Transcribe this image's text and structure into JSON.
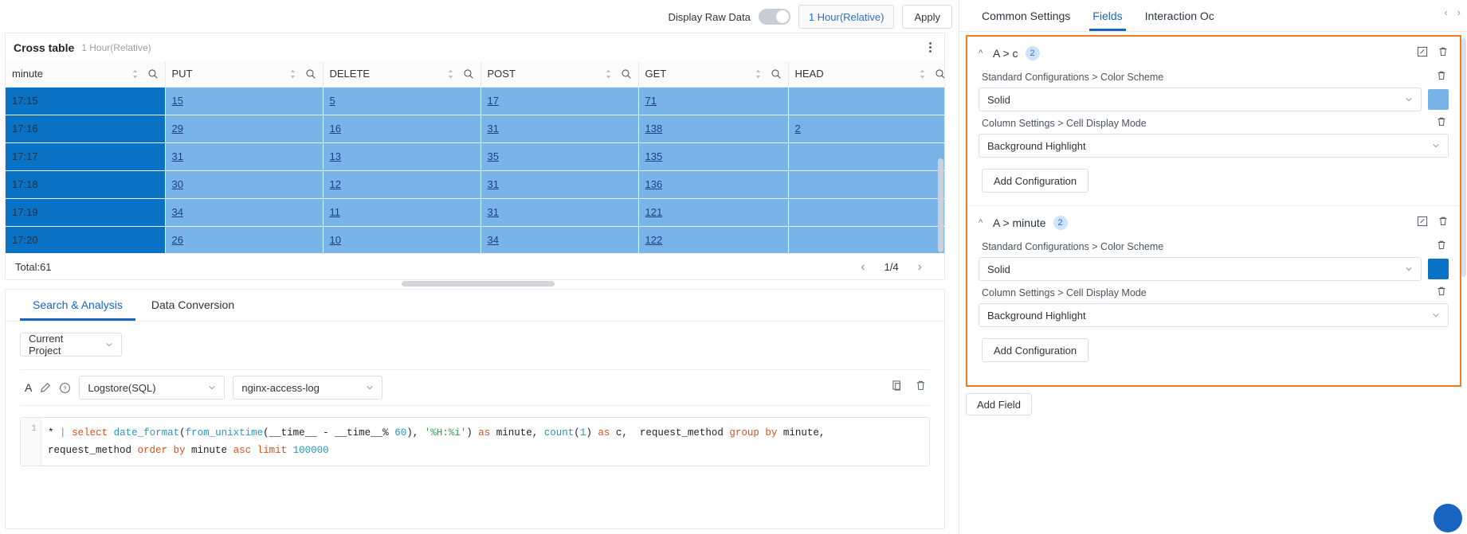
{
  "toolbar": {
    "raw_data_label": "Display Raw Data",
    "raw_data_on": false,
    "time_range": "1 Hour(Relative)",
    "apply_label": "Apply"
  },
  "cross_table": {
    "title": "Cross table",
    "subtitle": "1 Hour(Relative)",
    "more_icon": "kebab-menu-icon",
    "columns": [
      "minute",
      "PUT",
      "DELETE",
      "POST",
      "GET",
      "HEAD"
    ],
    "rows": [
      {
        "minute": "17:15",
        "PUT": "15",
        "DELETE": "5",
        "POST": "17",
        "GET": "71",
        "HEAD": ""
      },
      {
        "minute": "17:16",
        "PUT": "29",
        "DELETE": "16",
        "POST": "31",
        "GET": "138",
        "HEAD": "2"
      },
      {
        "minute": "17:17",
        "PUT": "31",
        "DELETE": "13",
        "POST": "35",
        "GET": "135",
        "HEAD": ""
      },
      {
        "minute": "17:18",
        "PUT": "30",
        "DELETE": "12",
        "POST": "31",
        "GET": "136",
        "HEAD": ""
      },
      {
        "minute": "17:19",
        "PUT": "34",
        "DELETE": "11",
        "POST": "31",
        "GET": "121",
        "HEAD": ""
      },
      {
        "minute": "17:20",
        "PUT": "26",
        "DELETE": "10",
        "POST": "34",
        "GET": "122",
        "HEAD": ""
      }
    ],
    "total": "Total:61",
    "page": "1/4",
    "prev_icon": "chevron-left-icon",
    "next_icon": "chevron-right-icon",
    "key_column_color": "#0a72c4",
    "value_column_color": "#79b4e8"
  },
  "bottom": {
    "tabs": [
      {
        "label": "Search & Analysis",
        "active": true
      },
      {
        "label": "Data Conversion",
        "active": false
      }
    ],
    "project_select": "Current Project",
    "query_letter": "A",
    "logstore_select": "Logstore(SQL)",
    "store_select": "nginx-access-log",
    "sql_line_number": "1",
    "sql": {
      "star": "*",
      "pipe": "|",
      "full_text": "* | select date_format(from_unixtime(__time__ - __time__% 60), '%H:%i') as minute, count(1) as c,  request_method group by minute, request_method order by minute asc limit 100000",
      "tokens": [
        {
          "t": "*",
          "c": "star"
        },
        {
          "t": " ",
          "c": "id"
        },
        {
          "t": "|",
          "c": "pipe"
        },
        {
          "t": " ",
          "c": "id"
        },
        {
          "t": "select",
          "c": "kw"
        },
        {
          "t": " ",
          "c": "id"
        },
        {
          "t": "date_format",
          "c": "fn"
        },
        {
          "t": "(",
          "c": "id"
        },
        {
          "t": "from_unixtime",
          "c": "fn"
        },
        {
          "t": "(__time__ - __time__% ",
          "c": "id"
        },
        {
          "t": "60",
          "c": "num"
        },
        {
          "t": "), ",
          "c": "id"
        },
        {
          "t": "'%H:%i'",
          "c": "str"
        },
        {
          "t": ") ",
          "c": "id"
        },
        {
          "t": "as",
          "c": "kw"
        },
        {
          "t": " minute, ",
          "c": "id"
        },
        {
          "t": "count",
          "c": "fn"
        },
        {
          "t": "(",
          "c": "id"
        },
        {
          "t": "1",
          "c": "num"
        },
        {
          "t": ") ",
          "c": "id"
        },
        {
          "t": "as",
          "c": "kw"
        },
        {
          "t": " c,  request_method ",
          "c": "id"
        },
        {
          "t": "group by",
          "c": "kw"
        },
        {
          "t": " minute,",
          "c": "id"
        }
      ],
      "tokens_line2": [
        {
          "t": "request_method ",
          "c": "id"
        },
        {
          "t": "order by",
          "c": "kw"
        },
        {
          "t": " minute ",
          "c": "id"
        },
        {
          "t": "asc",
          "c": "kw"
        },
        {
          "t": " ",
          "c": "id"
        },
        {
          "t": "limit",
          "c": "kw"
        },
        {
          "t": " ",
          "c": "id"
        },
        {
          "t": "100000",
          "c": "num"
        }
      ]
    }
  },
  "right_panel": {
    "tabs": [
      {
        "label": "Common Settings",
        "active": false
      },
      {
        "label": "Fields",
        "active": true
      },
      {
        "label": "Interaction Oc",
        "active": false
      }
    ],
    "nav_prev_icon": "chevron-left-icon",
    "nav_next_icon": "chevron-right-icon",
    "highlight_border_color": "#f07b20",
    "groups": [
      {
        "caret": "^",
        "title": "A > c",
        "badge": "2",
        "edit_icon": "edit-square-icon",
        "delete_icon": "trash-icon",
        "configs": [
          {
            "label": "Standard Configurations > Color Scheme",
            "value": "Solid",
            "has_swatch": true,
            "swatch_color": "#79b4e8",
            "delete_icon": "trash-icon"
          },
          {
            "label": "Column Settings > Cell Display Mode",
            "value": "Background Highlight",
            "has_swatch": false,
            "delete_icon": "trash-icon"
          }
        ],
        "add_label": "Add Configuration"
      },
      {
        "caret": "^",
        "title": "A > minute",
        "badge": "2",
        "edit_icon": "edit-square-icon",
        "delete_icon": "trash-icon",
        "configs": [
          {
            "label": "Standard Configurations > Color Scheme",
            "value": "Solid",
            "has_swatch": true,
            "swatch_color": "#0a72c4",
            "delete_icon": "trash-icon"
          },
          {
            "label": "Column Settings > Cell Display Mode",
            "value": "Background Highlight",
            "has_swatch": false,
            "delete_icon": "trash-icon"
          }
        ],
        "add_label": "Add Configuration"
      }
    ],
    "add_field_label": "Add Field"
  }
}
